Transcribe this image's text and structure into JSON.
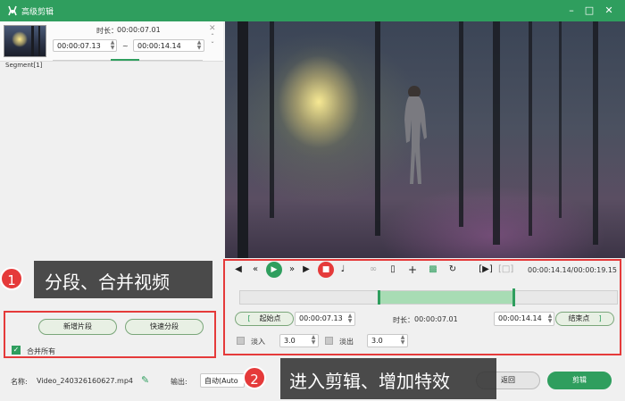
{
  "window": {
    "title": "高级剪辑"
  },
  "segment": {
    "duration_label": "时长：",
    "duration_value": "00:00:07.01",
    "start": "00:00:07.13",
    "end": "00:00:14.14",
    "separator": "~",
    "label": "Segment[1]"
  },
  "callouts": [
    {
      "number": "1",
      "text": "分段、合并视频"
    },
    {
      "number": "2",
      "text": "进入剪辑、增加特效"
    }
  ],
  "left_buttons": {
    "new_segment": "新增片段",
    "quick_split": "快速分段",
    "merge_all": "合并所有",
    "merge_all_checked": true
  },
  "controls": {
    "time_display": "00:00:14.14/00:00:19.15"
  },
  "trim": {
    "start_btn": "起始点",
    "start_value": "00:00:07.13",
    "duration_label": "时长：",
    "duration_value": "00:00:07.01",
    "end_value": "00:00:14.14",
    "end_btn": "结束点",
    "bracket_left": "[",
    "bracket_right": "]",
    "fade_in_label": "淡入",
    "fade_in_value": "3.0",
    "fade_out_label": "淡出",
    "fade_out_value": "3.0",
    "selection_start_fraction": 0.373,
    "selection_end_fraction": 0.735
  },
  "bottom": {
    "name_label": "名称:",
    "filename": "Video_240326160627.mp4",
    "output_label": "输出:",
    "output_value": "自动(Auto",
    "back_button": "返回",
    "clip_button": "剪辑"
  },
  "colors": {
    "brand_green": "#2f9e5e",
    "callout_red": "#e53a3a",
    "play_green": "#2f9e5e",
    "stop_red": "#e53a3a"
  }
}
